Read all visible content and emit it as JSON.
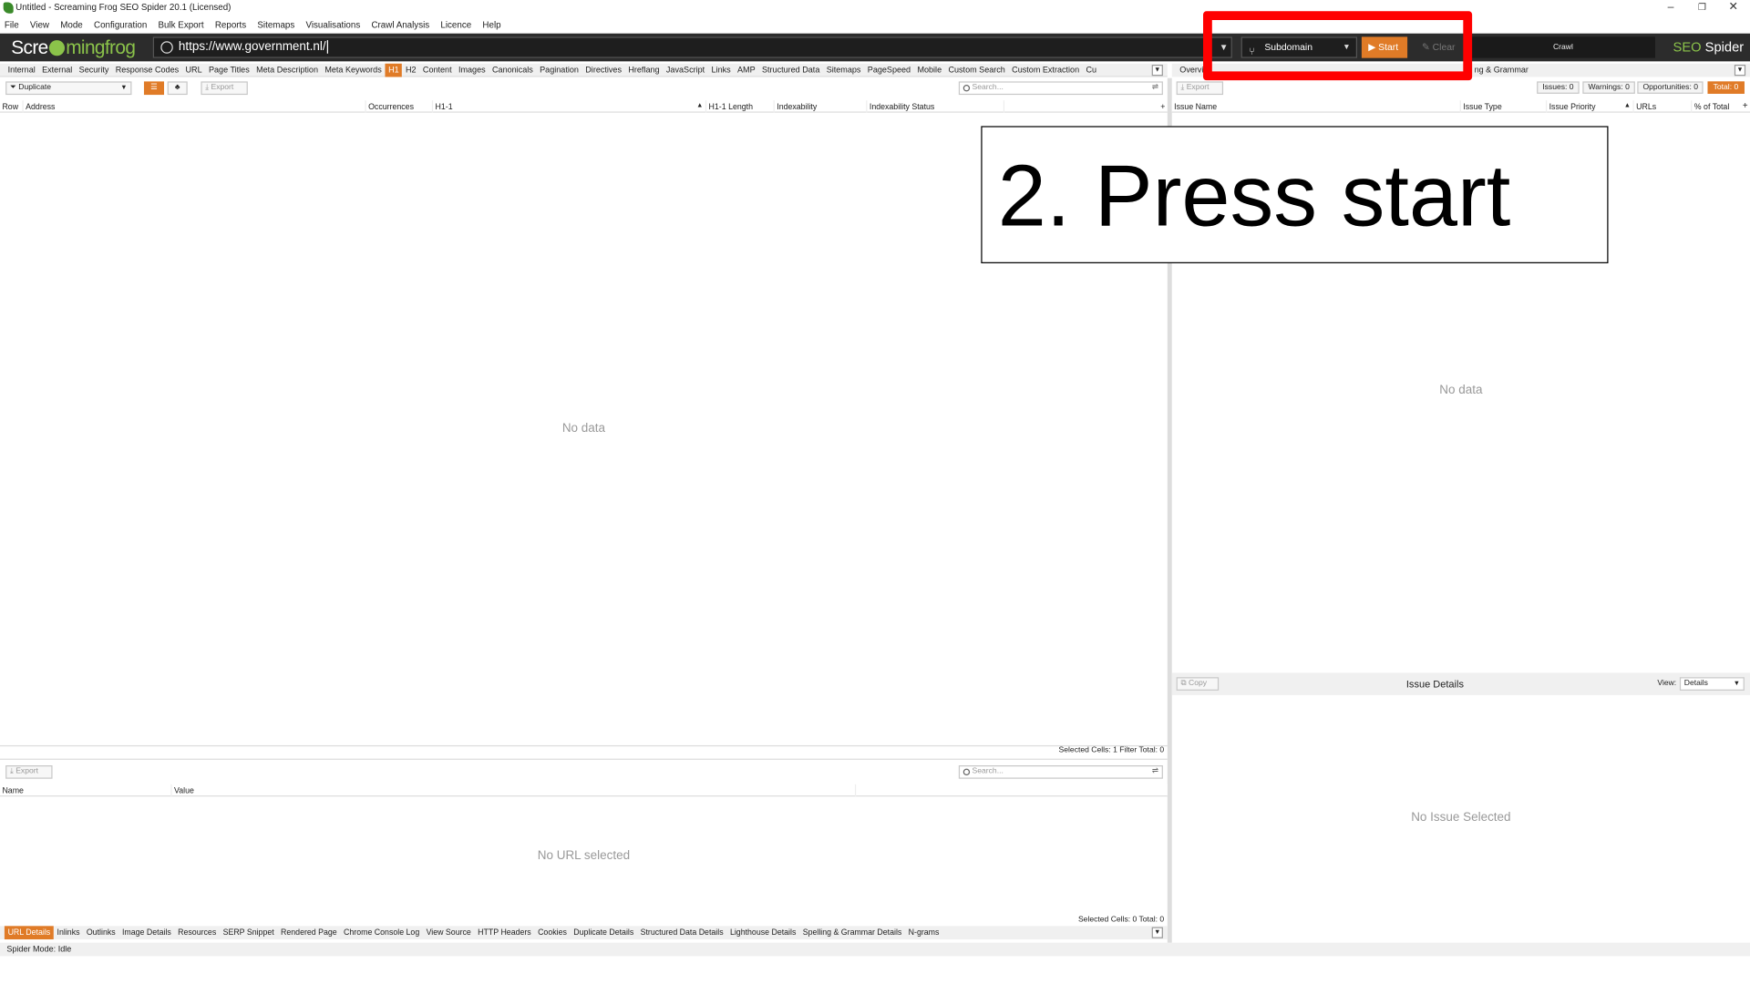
{
  "window": {
    "title": "Untitled - Screaming Frog SEO Spider 20.1 (Licensed)",
    "controls": [
      "–",
      "❐",
      "✕"
    ]
  },
  "menu": [
    "File",
    "View",
    "Mode",
    "Configuration",
    "Bulk Export",
    "Reports",
    "Sitemaps",
    "Visualisations",
    "Crawl Analysis",
    "Licence",
    "Help"
  ],
  "header": {
    "logo_pre": "Scre",
    "logo_post": "mingfrog",
    "url": "https://www.government.nl/",
    "mode": "Subdomain",
    "start_label": "Start",
    "clear_label": "Clear",
    "crawl_label": "Crawl",
    "brand_seo": "SEO",
    "brand_spider": "Spider"
  },
  "tabs": [
    "Internal",
    "External",
    "Security",
    "Response Codes",
    "URL",
    "Page Titles",
    "Meta Description",
    "Meta Keywords",
    "H1",
    "H2",
    "Content",
    "Images",
    "Canonicals",
    "Pagination",
    "Directives",
    "Hreflang",
    "JavaScript",
    "Links",
    "AMP",
    "Structured Data",
    "Sitemaps",
    "PageSpeed",
    "Mobile",
    "Custom Search",
    "Custom Extraction",
    "Cu"
  ],
  "active_tab": "H1",
  "right_tabs": {
    "left": "Overvi",
    "right": "ng & Grammar"
  },
  "filter": {
    "label": "Duplicate",
    "export_label": "Export",
    "search_placeholder": "Search..."
  },
  "main_table": {
    "columns": [
      "Row",
      "Address",
      "Occurrences",
      "H1-1",
      "H1-1 Length",
      "Indexability",
      "Indexability Status"
    ],
    "empty": "No data",
    "footer": "Selected Cells:  1  Filter Total:  0"
  },
  "issues": {
    "export_label": "Export",
    "chips": [
      "Issues: 0",
      "Warnings: 0",
      "Opportunities: 0",
      "Total: 0"
    ],
    "columns": [
      "Issue Name",
      "Issue Type",
      "Issue Priority",
      "URLs",
      "% of Total"
    ],
    "empty": "No data"
  },
  "issue_details": {
    "copy_label": "Copy",
    "title": "Issue Details",
    "view_label": "View:",
    "view_value": "Details",
    "empty": "No Issue Selected"
  },
  "details_panel": {
    "export_label": "Export",
    "search_placeholder": "Search...",
    "columns": [
      "Name",
      "Value"
    ],
    "empty": "No URL selected",
    "footer": "Selected Cells:  0  Total:  0"
  },
  "bottom_tabs": [
    "URL Details",
    "Inlinks",
    "Outlinks",
    "Image Details",
    "Resources",
    "SERP Snippet",
    "Rendered Page",
    "Chrome Console Log",
    "View Source",
    "HTTP Headers",
    "Cookies",
    "Duplicate Details",
    "Structured Data Details",
    "Lighthouse Details",
    "Spelling & Grammar Details",
    "N-grams"
  ],
  "status": "Spider Mode: Idle",
  "callout": "2. Press start",
  "colors": {
    "accent": "#e07b27",
    "header_bg": "#2c2c2c",
    "highlight": "#ff0000",
    "brand_green": "#8bc34a"
  }
}
